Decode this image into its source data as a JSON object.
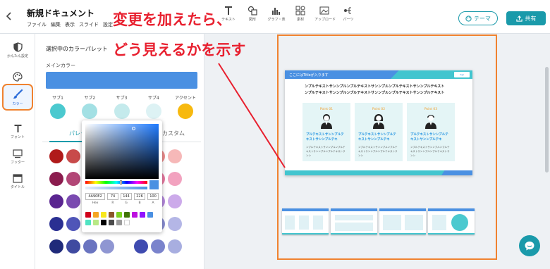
{
  "header": {
    "title": "新規ドキュメント",
    "menu": [
      "ファイル",
      "編集",
      "表示",
      "スライド",
      "設定"
    ],
    "tools": [
      {
        "label": "テキスト",
        "icon": "text-icon"
      },
      {
        "label": "図形",
        "icon": "shapes-icon"
      },
      {
        "label": "グラフ・表",
        "icon": "chart-icon"
      },
      {
        "label": "素材",
        "icon": "materials-icon"
      },
      {
        "label": "アップロード",
        "icon": "upload-icon"
      },
      {
        "label": "パーツ",
        "icon": "parts-icon"
      }
    ],
    "theme_label": "テーマ",
    "share_label": "共有"
  },
  "sidebar": {
    "items": [
      {
        "label": "かんたん設定",
        "icon": "shield-icon"
      },
      {
        "label": "",
        "icon": "palette-icon"
      },
      {
        "label": "カラー",
        "icon": "brush-icon",
        "active": true
      },
      {
        "label": "フォント",
        "icon": "text-t-icon"
      },
      {
        "label": "フッター",
        "icon": "monitor-icon"
      },
      {
        "label": "タイトル",
        "icon": "title-icon"
      }
    ]
  },
  "color_panel": {
    "heading": "選択中のカラーパレット",
    "main_label": "メインカラー",
    "main_color": "#4a90e2",
    "subs": [
      {
        "label": "サブ1",
        "color": "#4bc9cf"
      },
      {
        "label": "サブ2",
        "color": "#a3e0e4"
      },
      {
        "label": "サブ3",
        "color": "#c4eaec"
      },
      {
        "label": "サブ4",
        "color": "#ddf2f4"
      },
      {
        "label": "アクセント",
        "color": "#f7b90f"
      }
    ],
    "tab_palette": "パレット",
    "tab_custom": "カスタム",
    "palette_rows": [
      [
        "#b01a1a",
        "#c84a4a",
        "",
        "",
        "",
        "",
        "#f08e8e",
        "#f6b8b8"
      ],
      [
        "#8b1c4e",
        "#b24676",
        "",
        "",
        "",
        "",
        "#eb7aa2",
        "#f2a2bf"
      ],
      [
        "#5a2590",
        "#7a4ab0",
        "",
        "",
        "",
        "",
        "#b78ae0",
        "#ccaaea"
      ],
      [
        "#2a2f92",
        "#4f55b8",
        "#7a7fcc",
        "#9a9fda",
        "",
        "#5e63c2",
        "#8b8fd6",
        "#b4b6e6"
      ],
      [
        "#1f2a7a",
        "#3f4aa0",
        "#6a74c0",
        "#8f96d2",
        "",
        "#3f4bb0",
        "#7a83cc",
        "#a8aee0"
      ]
    ]
  },
  "picker": {
    "hex": "4A90E2",
    "r": "74",
    "g": "144",
    "b": "226",
    "a": "100",
    "hex_label": "Hex",
    "r_label": "R",
    "g_label": "G",
    "b_label": "B",
    "a_label": "A",
    "presets": [
      "#d0021b",
      "#f5a623",
      "#f8e71c",
      "#8b572a",
      "#7ed321",
      "#417505",
      "#bd10e0",
      "#9013fe",
      "#4a90e2",
      "#50e3c2",
      "#b8e986",
      "#000000",
      "#4a4a4a",
      "#9b9b9b",
      "#ffffff"
    ]
  },
  "annotation": {
    "line1": "変更を加えたら、",
    "line2": "どう見えるかを示す",
    "color": "#e8202f"
  },
  "slide": {
    "header_text": "ここにはTitleが入ります",
    "logo_text": "logo",
    "lead_line": "ンプルテキストサンンプルンプルテキストサンンプルンプルテキストサンンプルテキスト",
    "points": [
      {
        "title": "Point 01",
        "body": "プルテキストサンンプルテキストサンンプルテキ",
        "sub": "ンプルテキストサンンプルンプルテキストサンンプルンプルテキストサンン"
      },
      {
        "title": "Point 02",
        "body": "プルテキストサンンプルテキストサンンプルテキ",
        "sub": "ンプルテキストサンンプルンプルテキストサンンプルンプルテキストサンン"
      },
      {
        "title": "Point 03",
        "body": "プルテキストサンンプルテキストサンンプルテキ",
        "sub": "ンプルテキストサンンプルンプルテキストサンンプルンプルテキストサンン"
      }
    ]
  },
  "accent_colors": {
    "teal": "#1a9aaa",
    "orange": "#f0822f",
    "blue": "#4a90e2"
  }
}
